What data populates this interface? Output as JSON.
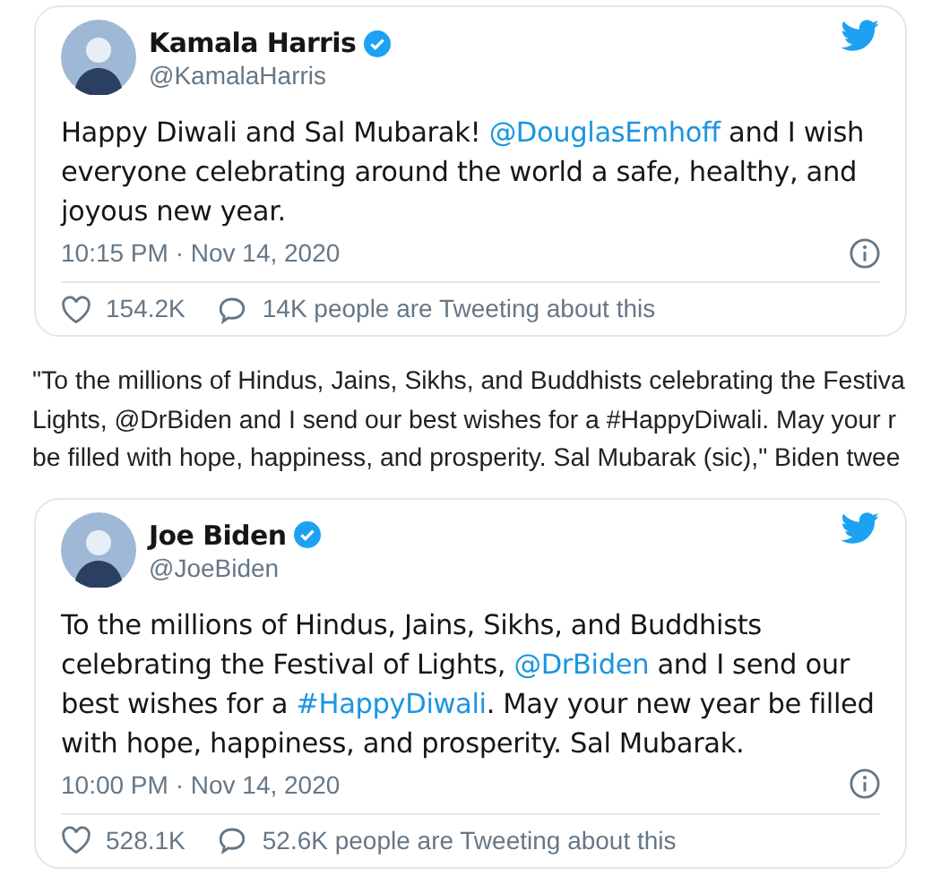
{
  "tweets": [
    {
      "name": "Kamala Harris",
      "verified": true,
      "handle": "@KamalaHarris",
      "body": [
        [
          {
            "text": "Happy Diwali and Sal Mubarak! ",
            "link": false
          },
          {
            "text": "@DouglasEmhoff",
            "link": true
          },
          {
            "text": " and I wish",
            "link": false
          }
        ],
        [
          {
            "text": "everyone celebrating around the world a safe, healthy, and",
            "link": false
          }
        ],
        [
          {
            "text": "joyous new year.",
            "link": false
          }
        ]
      ],
      "time": "10:15 PM · Nov 14, 2020",
      "likes": "154.2K",
      "talk": "14K people are Tweeting about this"
    },
    {
      "name": "Joe Biden",
      "verified": true,
      "handle": "@JoeBiden",
      "body": [
        [
          {
            "text": "To the millions of Hindus, Jains, Sikhs, and Buddhists",
            "link": false
          }
        ],
        [
          {
            "text": "celebrating the Festival of Lights, ",
            "link": false
          },
          {
            "text": "@DrBiden",
            "link": true
          },
          {
            "text": " and I send our",
            "link": false
          }
        ],
        [
          {
            "text": "best wishes for a ",
            "link": false
          },
          {
            "text": "#HappyDiwali",
            "link": true
          },
          {
            "text": ". May your new year be filled",
            "link": false
          }
        ],
        [
          {
            "text": "with hope, happiness, and prosperity. Sal Mubarak.",
            "link": false
          }
        ]
      ],
      "time": "10:00 PM · Nov 14, 2020",
      "likes": "528.1K",
      "talk": "52.6K people are Tweeting about this"
    }
  ],
  "article": {
    "lines": [
      "\"To the millions of Hindus, Jains, Sikhs, and Buddhists celebrating the Festiva",
      "Lights, @DrBiden and I send our best wishes for a #HappyDiwali. May your r",
      "be filled with hope, happiness, and prosperity. Sal Mubarak (sic),\" Biden twee"
    ]
  }
}
